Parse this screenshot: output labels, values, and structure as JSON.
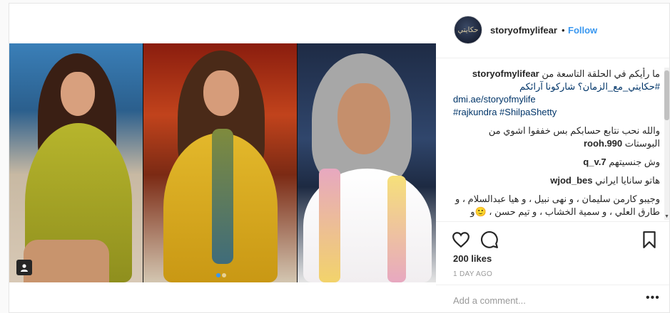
{
  "post": {
    "username": "storyofmylifear",
    "avatar_text": "حكايتي",
    "follow_label": "Follow",
    "bullet": "•",
    "caption": {
      "username": "storyofmylifear",
      "line1": "ما رأيكم في الحلقة التاسعة من",
      "line2": "#حكايتي_مع_الزمان؟ شاركونا آرائكم",
      "link": "dmi.ae/storyofmylife",
      "hashtags": "#rajkundra #ShilpaShetty"
    },
    "comments": [
      {
        "user": "rooh.990",
        "text": "والله نحب نتابع حسابكم بس خففوا اشوي من البوستات"
      },
      {
        "user": "q_v.7",
        "text": "وش جنسيتهم"
      },
      {
        "user": "wjod_bes",
        "text": "هاتو سانايا ايراني"
      },
      {
        "user": "wjod_bes",
        "text": "وجيبو كارمن سليمان ، و نهى نبيل ، و هيا عبدالسلام ، و طارق العلي ، و سمية الخشاب ، و تيم حسن ، 🙂و شيرين الواحدي ، و وافي ، و فري الصبان"
      }
    ],
    "likes": "200 likes",
    "time": "1 DAY AGO",
    "add_comment_placeholder": "Add a comment...",
    "more_icon": "•••",
    "colors": {
      "accent": "#3897f0",
      "link": "#003569",
      "muted": "#999999"
    }
  }
}
